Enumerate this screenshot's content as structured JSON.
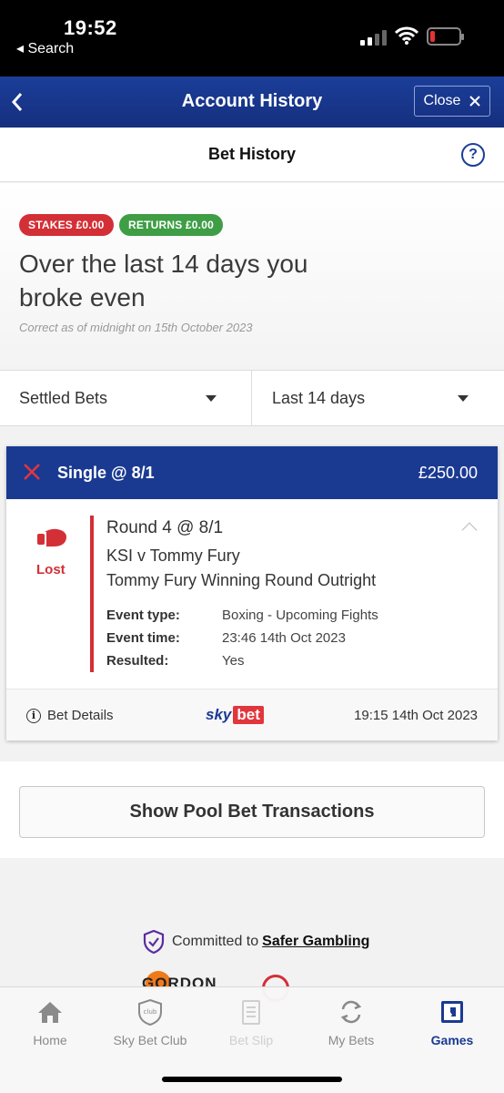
{
  "status_bar": {
    "time": "19:52",
    "back_label": "◂ Search"
  },
  "header": {
    "title": "Account History",
    "close_label": "Close",
    "back_icon": "chevron-left-icon"
  },
  "subheader": {
    "title": "Bet History",
    "help": "?"
  },
  "summary": {
    "stakes": "STAKES £0.00",
    "returns": "RETURNS £0.00",
    "headline": "Over the last 14 days you broke even",
    "note": "Correct as of midnight on 15th October 2023"
  },
  "filters": {
    "status": "Settled Bets",
    "period": "Last 14 days"
  },
  "bet": {
    "type": "Single @ 8/1",
    "stake": "£250.00",
    "result": "Lost",
    "selection": "Round 4 @ 8/1",
    "event": "KSI v Tommy Fury",
    "market": "Tommy Fury Winning Round Outright",
    "details": [
      {
        "label": "Event type:",
        "value": "Boxing - Upcoming Fights"
      },
      {
        "label": "Event time:",
        "value": "23:46 14th Oct 2023"
      },
      {
        "label": "Resulted:",
        "value": "Yes"
      }
    ],
    "details_label": "Bet Details",
    "brand_sky": "sky",
    "brand_bet": "bet",
    "placed": "19:15 14th Oct 2023"
  },
  "pool_button": "Show Pool Bet Transactions",
  "safer": {
    "prefix": "Committed to",
    "link": "Safer Gambling"
  },
  "partner": "GORDON",
  "tabs": [
    {
      "label": "Home",
      "icon": "home-icon"
    },
    {
      "label": "Sky Bet Club",
      "icon": "club-badge-icon"
    },
    {
      "label": "Bet Slip",
      "icon": "bet-slip-icon"
    },
    {
      "label": "My Bets",
      "icon": "refresh-icon"
    },
    {
      "label": "Games",
      "icon": "games-icon"
    }
  ],
  "colors": {
    "brand_blue": "#1a3a92",
    "red": "#d32f36",
    "green": "#3e9d45"
  }
}
